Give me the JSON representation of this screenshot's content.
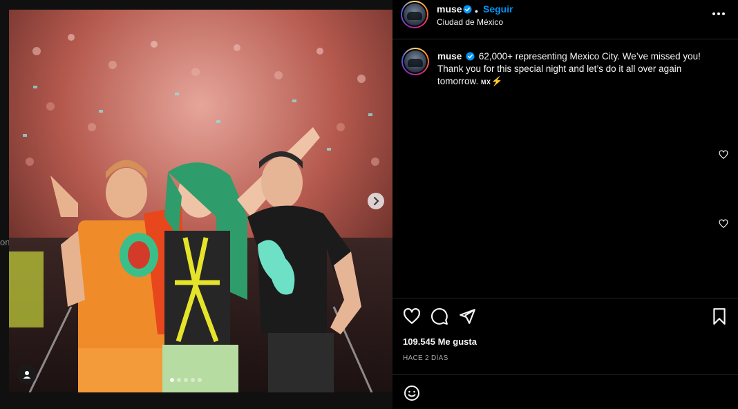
{
  "left_ghost_text": "on",
  "post": {
    "image_alt": "Three band members posing on stage in front of a large crowd",
    "carousel_dots": 5,
    "carousel_active_index": 0
  },
  "header": {
    "username": "muse",
    "separator": "•",
    "follow_label": "Seguir",
    "location": "Ciudad de México"
  },
  "caption": {
    "username": "muse",
    "text_line1": "62,000+ representing Mexico City. We’ve missed you!",
    "text_line2": "Thank you for this special night and let’s do it all over again",
    "text_line3": "tomorrow.",
    "flag": "MX",
    "bolt": "⚡"
  },
  "stats": {
    "likes": "109.545 Me gusta",
    "time_ago": "HACE 2 DÍAS"
  },
  "colors": {
    "accent": "#0095f6",
    "background": "#000000",
    "divider": "#262626"
  },
  "icons": {
    "like": "heart-icon",
    "comment": "comment-icon",
    "share": "send-icon",
    "save": "bookmark-icon",
    "emoji": "emoji-icon",
    "more": "more-options-icon",
    "next": "chevron-right-icon",
    "tag": "user-tag-icon"
  }
}
